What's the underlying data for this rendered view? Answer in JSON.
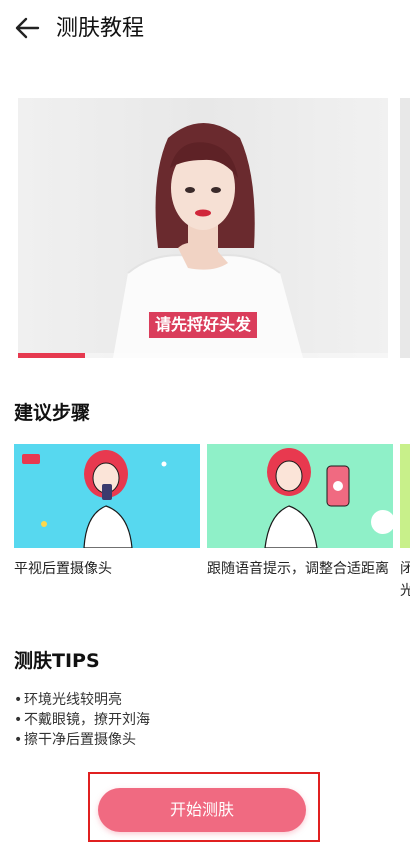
{
  "header": {
    "title": "测肤教程"
  },
  "video": {
    "caption": "请先捋好头发",
    "progress": 0.18
  },
  "steps": {
    "title": "建议步骤",
    "items": [
      {
        "label": "平视后置摄像头"
      },
      {
        "label": "跟随语音提示，调整合适距离"
      },
      {
        "label": "闭光"
      }
    ]
  },
  "tips": {
    "title": "测肤TIPS",
    "items": [
      "环境光线较明亮",
      "不戴眼镜，撩开刘海",
      "擦干净后置摄像头"
    ]
  },
  "cta": {
    "label": "开始测肤"
  },
  "colors": {
    "accent": "#f06a81",
    "caption_bg": "#d72d4d",
    "highlight": "#e02020"
  }
}
